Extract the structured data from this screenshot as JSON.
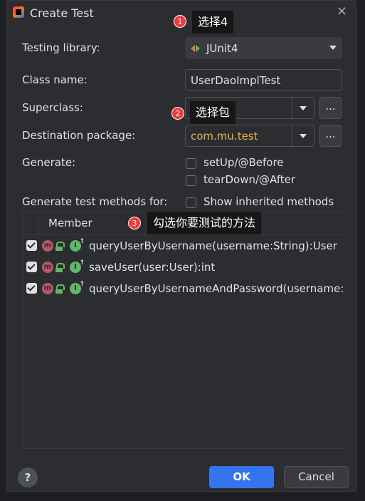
{
  "dialog": {
    "title": "Create Test"
  },
  "form": {
    "testing_library_label": "Testing library:",
    "testing_library_value": "JUnit4",
    "class_name_label": "Class name:",
    "class_name_value": "UserDaoImplTest",
    "superclass_label": "Superclass:",
    "superclass_value": "",
    "destination_package_label": "Destination package:",
    "destination_package_value": "com.mu.test",
    "browse_label": "...",
    "generate_label": "Generate:",
    "setup_label": "setUp/@Before",
    "teardown_label": "tearDown/@After",
    "methods_for_label": "Generate test methods for:",
    "show_inherited_label": "Show inherited methods"
  },
  "members": {
    "header": "Member",
    "rows": [
      {
        "signature": "queryUserByUsername(username:String):User",
        "checked": true
      },
      {
        "signature": "saveUser(user:User):int",
        "checked": true
      },
      {
        "signature": "queryUserByUsernameAndPassword(username:",
        "checked": true
      }
    ]
  },
  "buttons": {
    "help": "?",
    "ok": "OK",
    "cancel": "Cancel"
  },
  "annotations": [
    {
      "number": "1",
      "text": "选择4"
    },
    {
      "number": "2",
      "text": "选择包"
    },
    {
      "number": "3",
      "text": "勾选你要测试的方法"
    }
  ],
  "colors": {
    "background": "#2b2d30",
    "accent": "#3574f0",
    "badge": "#f03a3a"
  }
}
